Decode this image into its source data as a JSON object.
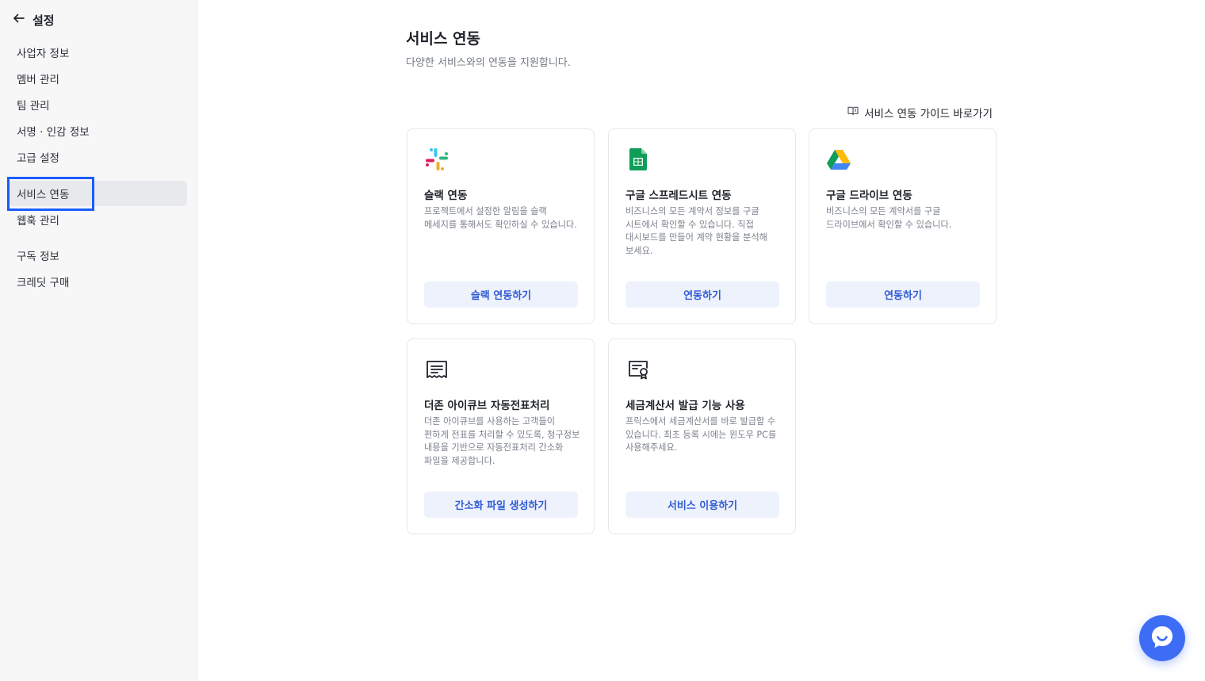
{
  "sidebar": {
    "title": "설정",
    "items": [
      {
        "label": "사업자 정보"
      },
      {
        "label": "멤버 관리"
      },
      {
        "label": "팀 관리"
      },
      {
        "label": "서명 · 인감 정보"
      },
      {
        "label": "고급 설정"
      },
      {
        "label": "서비스 연동",
        "active": true
      },
      {
        "label": "웹훅 관리"
      },
      {
        "label": "구독 정보"
      },
      {
        "label": "크레딧 구매"
      }
    ]
  },
  "main": {
    "title": "서비스 연동",
    "subtitle": "다양한 서비스와의 연동을 지원합니다.",
    "guide_link": "서비스 연동 가이드 바로가기",
    "cards": [
      {
        "icon": "slack-icon",
        "title": "슬랙 연동",
        "desc": "프로젝트에서 설정한 알림을 슬랙 메세지를 통해서도 확인하실 수 있습니다.",
        "button": "슬랙 연동하기"
      },
      {
        "icon": "google-sheets-icon",
        "title": "구글 스프레드시트 연동",
        "desc": "비즈니스의 모든 계약서 정보를 구글 시트에서 확인할 수 있습니다. 직접 대시보드를 만들어 계약 현황을 분석해 보세요.",
        "button": "연동하기"
      },
      {
        "icon": "google-drive-icon",
        "title": "구글 드라이브 연동",
        "desc": "비즈니스의 모든 계약서를 구글 드라이브에서 확인할 수 있습니다.",
        "button": "연동하기"
      },
      {
        "icon": "receipt-icon",
        "title": "더존 아이큐브 자동전표처리",
        "desc": "더존 아이큐브를 사용하는 고객들이 편하게 전표를 처리할 수 있도록, 청구정보 내용을 기반으로 자동전표처리 간소화 파일을 제공합니다.",
        "button": "간소화 파일 생성하기"
      },
      {
        "icon": "tax-invoice-icon",
        "title": "세금계산서 발급 기능 사용",
        "desc": "프릭스에서 세금계산서를 바로 발급할 수 있습니다. 최초 등록 시에는 윈도우 PC를 사용해주세요.",
        "button": "서비스 이용하기"
      }
    ]
  },
  "colors": {
    "accent": "#3d6df5",
    "button_bg": "#eef2fd",
    "button_text": "#2f5bd3",
    "focus_outline": "#1a5cff"
  }
}
